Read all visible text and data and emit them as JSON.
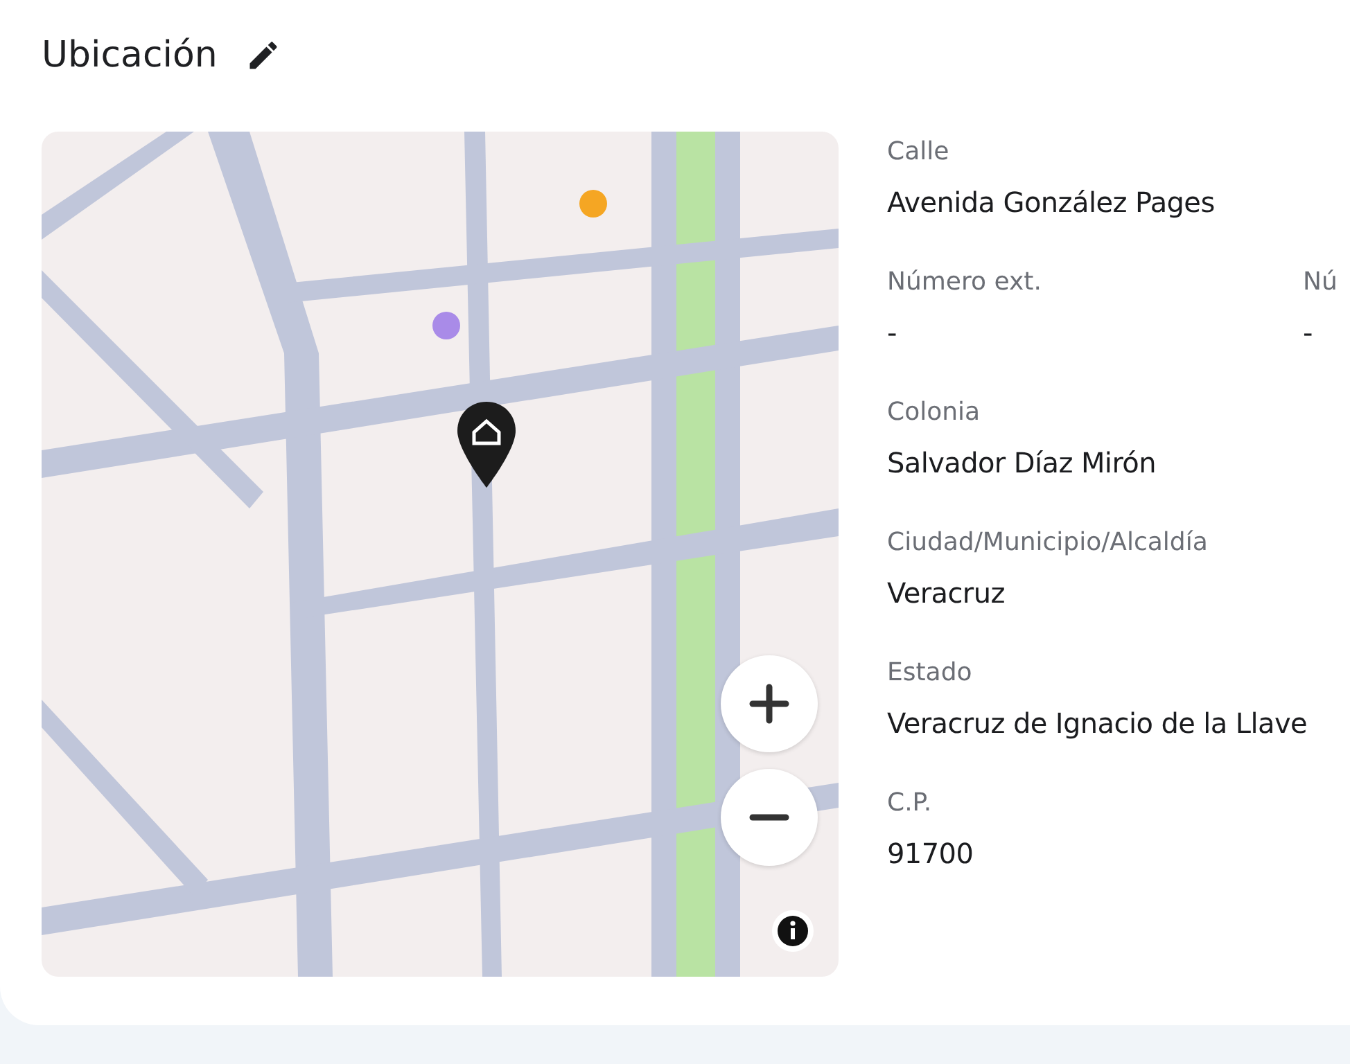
{
  "section": {
    "title": "Ubicación"
  },
  "fields": [
    {
      "label": "Calle",
      "value": "Avenida González Pages"
    },
    {
      "label": "Número ext.",
      "value": "-",
      "pair": {
        "label": "Nú",
        "value": "-"
      }
    },
    {
      "label": "Colonia",
      "value": "Salvador Díaz Mirón"
    },
    {
      "label": "Ciudad/Municipio/Alcaldía",
      "value": "Veracruz"
    },
    {
      "label": "Estado",
      "value": "Veracruz de Ignacio de la Llave"
    },
    {
      "label": "C.P.",
      "value": "91700"
    }
  ]
}
